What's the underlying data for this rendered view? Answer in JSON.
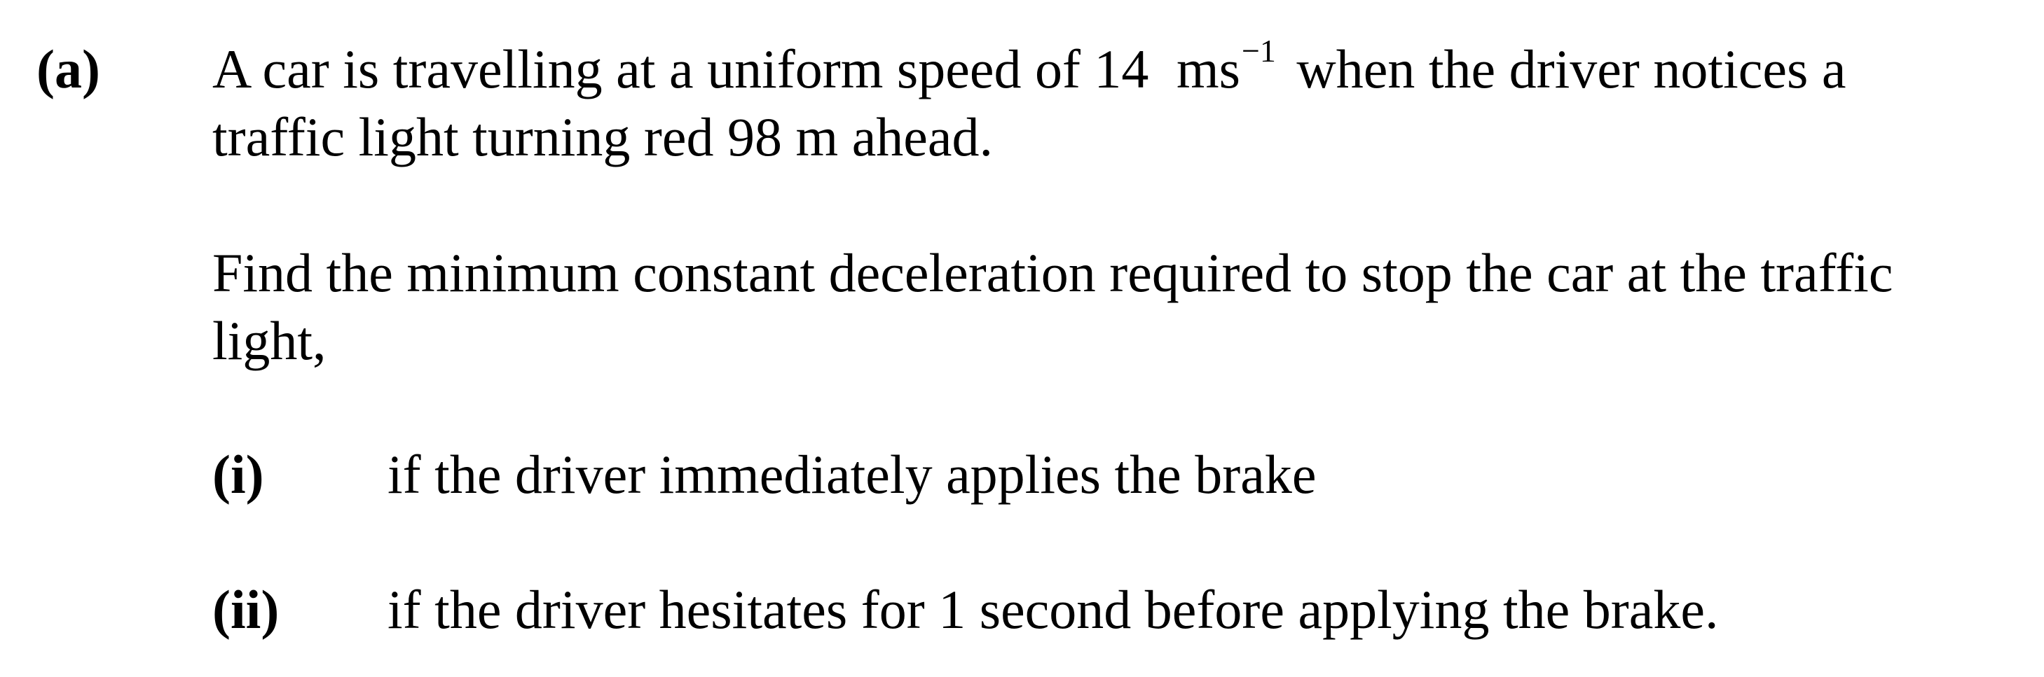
{
  "part": {
    "label": "(a)",
    "stem": {
      "line1_part1": "A car is travelling at a uniform speed of 14",
      "unit_base": "ms",
      "unit_exponent": "−1",
      "line1_part2": "when the driver notices a",
      "line2": "traffic light turning red 98 m ahead."
    },
    "instruction": {
      "line1": "Find the minimum constant deceleration required to stop the car at the traffic",
      "line2": "light,"
    },
    "subparts": [
      {
        "label": "(i)",
        "text": "if the driver immediately applies the brake"
      },
      {
        "label": "(ii)",
        "text": "if the driver hesitates for 1 second before applying the brake."
      }
    ]
  }
}
